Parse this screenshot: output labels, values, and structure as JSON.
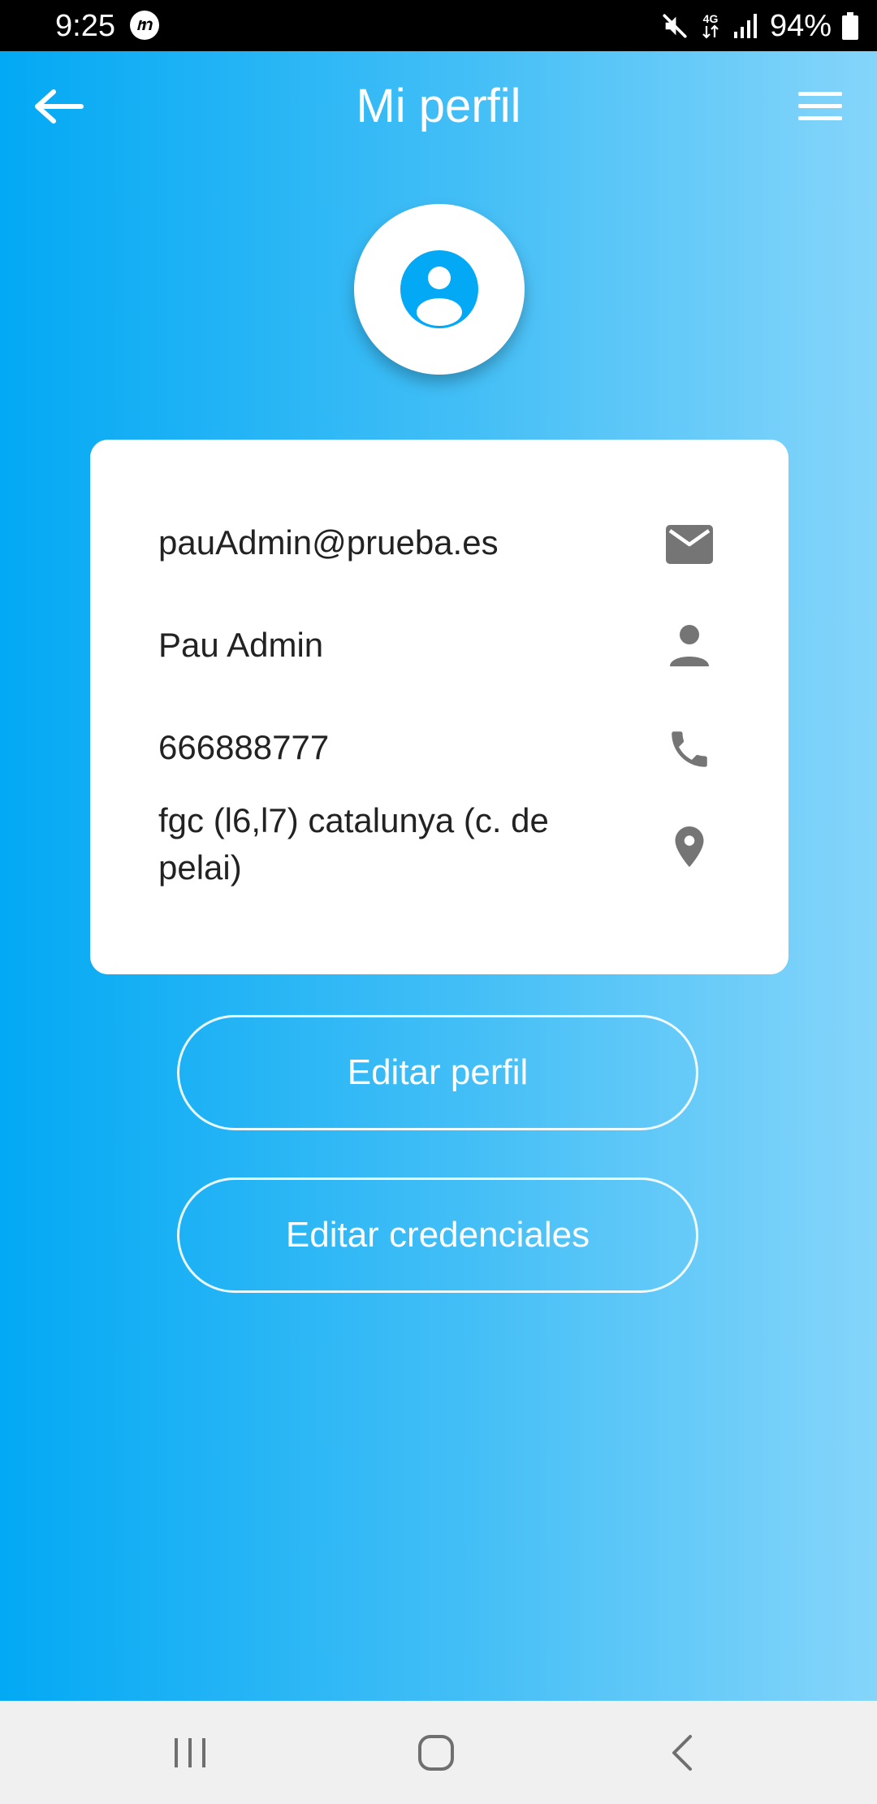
{
  "status_bar": {
    "time": "9:25",
    "battery": "94%",
    "network": "4G"
  },
  "header": {
    "title": "Mi perfil",
    "back_icon": "arrow-left-icon",
    "menu_icon": "hamburger-menu-icon"
  },
  "profile": {
    "avatar_icon": "account-circle-icon",
    "email": "pauAdmin@prueba.es",
    "name": "Pau Admin",
    "phone": "666888777",
    "address": "fgc (l6,l7) catalunya (c. de pelai)"
  },
  "buttons": {
    "edit_profile": "Editar perfil",
    "edit_credentials": "Editar credenciales"
  },
  "colors": {
    "accent": "#03a9f4",
    "icon_gray": "#757575",
    "text_dark": "#222222"
  }
}
